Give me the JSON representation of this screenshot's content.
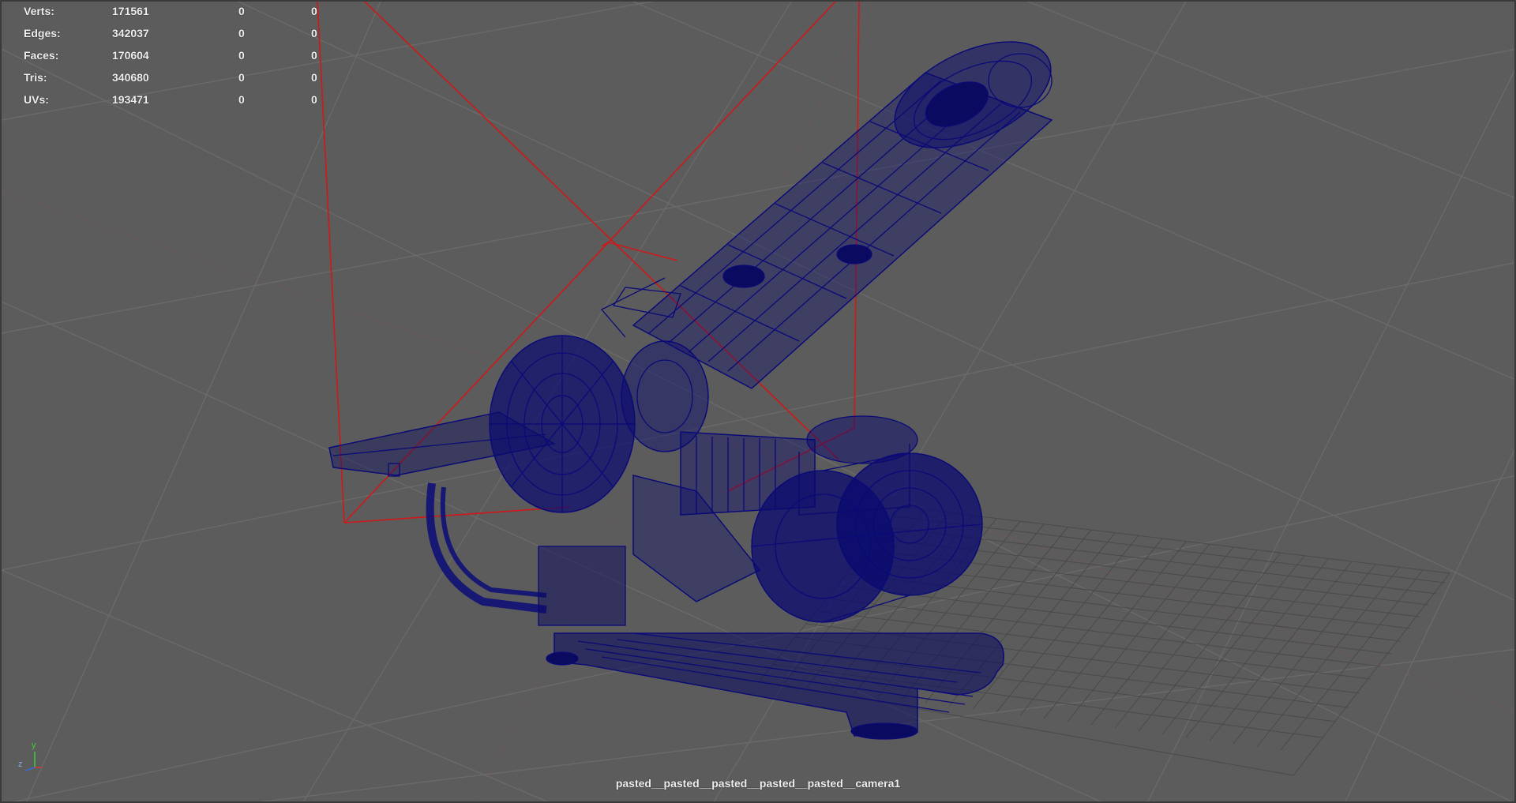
{
  "hud": {
    "rows": [
      {
        "label": "Verts:",
        "value": "171561",
        "c2": "0",
        "c3": "0"
      },
      {
        "label": "Edges:",
        "value": "342037",
        "c2": "0",
        "c3": "0"
      },
      {
        "label": "Faces:",
        "value": "170604",
        "c2": "0",
        "c3": "0"
      },
      {
        "label": "Tris:",
        "value": "340680",
        "c2": "0",
        "c3": "0"
      },
      {
        "label": "UVs:",
        "value": "193471",
        "c2": "0",
        "c3": "0"
      }
    ]
  },
  "camera": {
    "name": "pasted__pasted__pasted__pasted__pasted__camera1"
  },
  "axis_gizmo": {
    "y_label": "y",
    "z_label": "z"
  },
  "colors": {
    "viewport_bg": "#5c5c5c",
    "grid": "#6e6e6e",
    "grid_axis": "#8a5050",
    "wireframe": "#0a0a78",
    "camera_frustum": "#d01818",
    "ground_grid": "#4a4a4a",
    "hud_text": "#f0f0f0"
  },
  "scene": {
    "object": "wireframe-model",
    "display_mode": "wireframe"
  }
}
